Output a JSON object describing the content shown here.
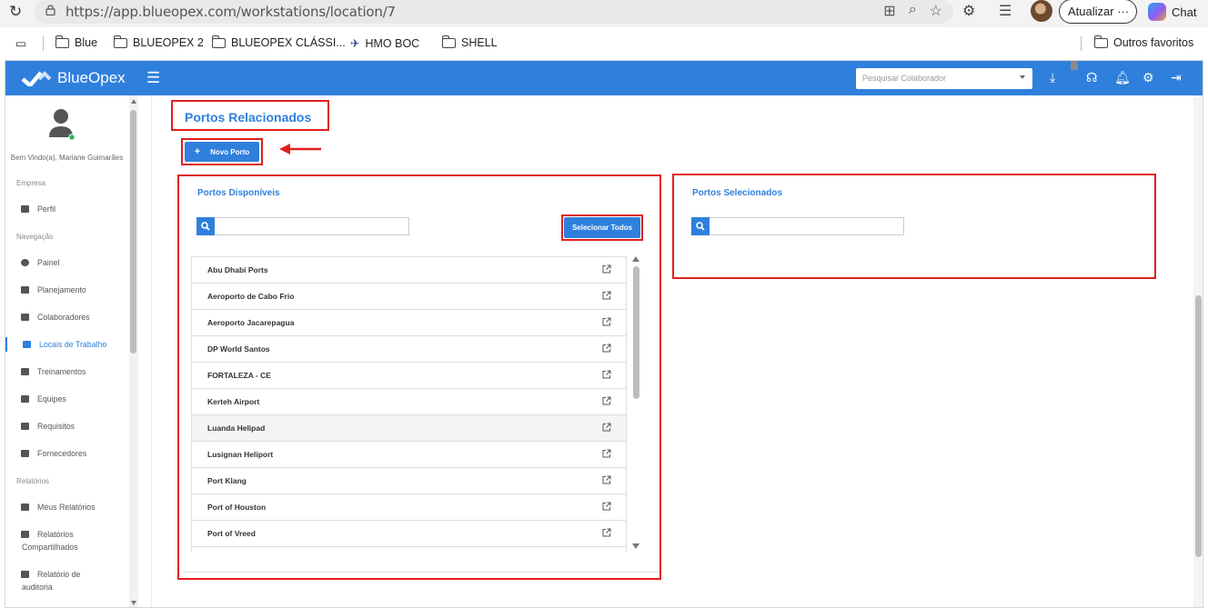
{
  "browser": {
    "url": "https://app.blueopex.com/workstations/location/7",
    "update_label": "Atualizar",
    "chat_label": "Chat",
    "bookmarks": [
      "Blue",
      "BLUEOPEX 2",
      "BLUEOPEX CLÁSSI...",
      "HMO BOC",
      "SHELL"
    ],
    "other_favorites": "Outros favoritos"
  },
  "app": {
    "brand": "BlueOpex",
    "search_placeholder": "Pesquisar Colaborador",
    "accent_color": "#2f80dc",
    "highlight_color": "#e0201d"
  },
  "sidebar": {
    "welcome": "Bem Vindo(a), Mariane Guimarães",
    "sections": {
      "empresa": "Empresa",
      "navegacao": "Navegação",
      "relatorios": "Relatórios"
    },
    "items": {
      "perfil": "Perfil",
      "painel": "Painel",
      "planejamento": "Planejamento",
      "colaboradores": "Colaboradores",
      "locais": "Locais de Trabalho",
      "treinamentos": "Treinamentos",
      "equipes": "Equipes",
      "requisitos": "Requisitos",
      "fornecedores": "Fornecedores",
      "meus_relatorios": "Meus Relatórios",
      "relatorios_comp_1": "Relatórios",
      "relatorios_comp_2": "Compartilhados",
      "auditoria_1": "Relatório de",
      "auditoria_2": "auditoria"
    }
  },
  "main": {
    "title": "Portos Relacionados",
    "new_button": "Novo Porto",
    "available": {
      "title": "Portos Disponíveis",
      "select_all": "Selecionar Todos",
      "ports": [
        "Abu Dhabi Ports",
        "Aeroporto de Cabo Frio",
        "Aeroporto Jacarepagua",
        "DP World Santos",
        "FORTALEZA - CE",
        "Kerteh Airport",
        "Luanda Helipad",
        "Lusignan Heliport",
        "Port Klang",
        "Port of Houston",
        "Port of Vreed"
      ]
    },
    "selected": {
      "title": "Portos Selecionados"
    }
  }
}
